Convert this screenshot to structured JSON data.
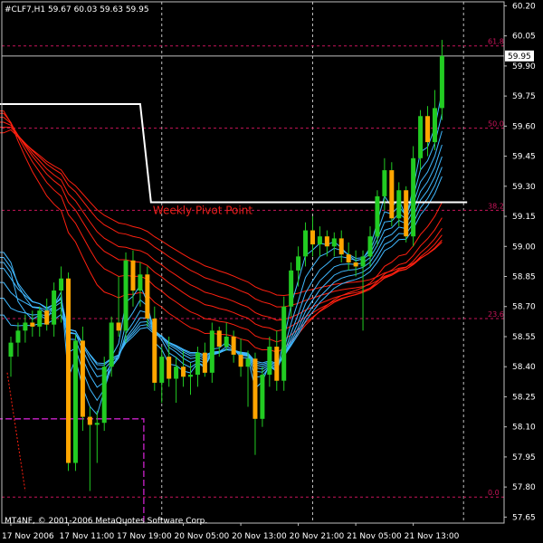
{
  "header": {
    "symbol_line": "#CLF7,H1  59.67 60.03 59.63 59.95"
  },
  "footer": {
    "copyright": "MT4NF, © 2001-2006 MetaQuotes Software Corp."
  },
  "colors": {
    "background": "#000000",
    "grid": "#c0c0c0",
    "bull": "#22cc22",
    "bear": "#ffa500",
    "wick": "#22cc22",
    "fib": "#c8145a",
    "pivot": "#ffffff",
    "pivot_label": "#e8201a",
    "red_ema": "#ff2010",
    "cyan_ema": "#40b8ff",
    "magenta": "#cc22cc",
    "current_price_bg": "#ffffff",
    "current_price_fg": "#000000"
  },
  "chart_data": {
    "type": "candlestick",
    "symbol": "#CLF7",
    "timeframe": "H1",
    "ohlc_last": {
      "open": 59.67,
      "high": 60.03,
      "low": 59.63,
      "close": 59.95
    },
    "current_price": "59.95",
    "y_axis": {
      "ylim": [
        57.62,
        60.22
      ],
      "ticks": [
        "60.20",
        "60.05",
        "59.90",
        "59.75",
        "59.60",
        "59.45",
        "59.30",
        "59.15",
        "59.00",
        "58.85",
        "58.70",
        "58.55",
        "58.40",
        "58.25",
        "58.10",
        "57.95",
        "57.80",
        "57.65"
      ]
    },
    "x_axis": {
      "labels": [
        "17 Nov 2006",
        "17 Nov 11:00",
        "17 Nov 19:00",
        "20 Nov 05:00",
        "20 Nov 13:00",
        "20 Nov 21:00",
        "21 Nov 05:00",
        "21 Nov 13:00"
      ],
      "label_bars": [
        0,
        8,
        16,
        24,
        32,
        40,
        48,
        56
      ],
      "gridline_bars": [
        21,
        42,
        63
      ]
    },
    "fib_levels": [
      {
        "label": "61.8",
        "price": 60.0
      },
      {
        "label": "50.0",
        "price": 59.59
      },
      {
        "label": "38.2",
        "price": 59.18
      },
      {
        "label": "23.6",
        "price": 58.64
      },
      {
        "label": "0.0",
        "price": 57.75
      }
    ],
    "weekly_pivot": {
      "label": "Weekly Pivot Point",
      "segments": [
        {
          "from_bar": -2,
          "to_bar": 18,
          "price": 59.71
        },
        {
          "from_bar": 19.5,
          "to_bar": 63.5,
          "price": 59.22
        }
      ]
    },
    "magenta_level": {
      "price": 58.14,
      "from_bar": -2,
      "to_bar": 18.5,
      "drop_to": 57.62
    },
    "candles": [
      {
        "o": 58.45,
        "h": 58.55,
        "l": 58.35,
        "c": 58.52
      },
      {
        "o": 58.52,
        "h": 58.62,
        "l": 58.45,
        "c": 58.58
      },
      {
        "o": 58.58,
        "h": 58.66,
        "l": 58.52,
        "c": 58.62
      },
      {
        "o": 58.62,
        "h": 58.68,
        "l": 58.55,
        "c": 58.6
      },
      {
        "o": 58.6,
        "h": 58.7,
        "l": 58.55,
        "c": 58.68
      },
      {
        "o": 58.68,
        "h": 58.74,
        "l": 58.58,
        "c": 58.61
      },
      {
        "o": 58.61,
        "h": 58.82,
        "l": 58.55,
        "c": 58.78
      },
      {
        "o": 58.78,
        "h": 58.9,
        "l": 58.62,
        "c": 58.84
      },
      {
        "o": 58.84,
        "h": 58.87,
        "l": 57.88,
        "c": 57.92
      },
      {
        "o": 57.92,
        "h": 58.56,
        "l": 57.88,
        "c": 58.53
      },
      {
        "o": 58.53,
        "h": 58.6,
        "l": 58.08,
        "c": 58.15
      },
      {
        "o": 58.15,
        "h": 58.2,
        "l": 57.78,
        "c": 58.11
      },
      {
        "o": 58.11,
        "h": 58.18,
        "l": 57.92,
        "c": 58.12
      },
      {
        "o": 58.12,
        "h": 58.45,
        "l": 58.08,
        "c": 58.4
      },
      {
        "o": 58.4,
        "h": 58.65,
        "l": 58.35,
        "c": 58.62
      },
      {
        "o": 58.62,
        "h": 58.85,
        "l": 58.55,
        "c": 58.58
      },
      {
        "o": 58.58,
        "h": 58.97,
        "l": 58.52,
        "c": 58.93
      },
      {
        "o": 58.93,
        "h": 58.98,
        "l": 58.7,
        "c": 58.78
      },
      {
        "o": 58.78,
        "h": 58.92,
        "l": 58.7,
        "c": 58.86
      },
      {
        "o": 58.86,
        "h": 58.9,
        "l": 58.6,
        "c": 58.64
      },
      {
        "o": 58.64,
        "h": 58.7,
        "l": 58.28,
        "c": 58.32
      },
      {
        "o": 58.32,
        "h": 58.5,
        "l": 58.22,
        "c": 58.45
      },
      {
        "o": 58.45,
        "h": 58.55,
        "l": 58.3,
        "c": 58.34
      },
      {
        "o": 58.34,
        "h": 58.45,
        "l": 58.22,
        "c": 58.4
      },
      {
        "o": 58.4,
        "h": 58.48,
        "l": 58.3,
        "c": 58.35
      },
      {
        "o": 58.35,
        "h": 58.42,
        "l": 58.26,
        "c": 58.36
      },
      {
        "o": 58.36,
        "h": 58.5,
        "l": 58.3,
        "c": 58.47
      },
      {
        "o": 58.47,
        "h": 58.52,
        "l": 58.35,
        "c": 58.37
      },
      {
        "o": 58.37,
        "h": 58.62,
        "l": 58.32,
        "c": 58.58
      },
      {
        "o": 58.58,
        "h": 58.6,
        "l": 58.45,
        "c": 58.5
      },
      {
        "o": 58.5,
        "h": 58.62,
        "l": 58.48,
        "c": 58.55
      },
      {
        "o": 58.55,
        "h": 58.58,
        "l": 58.42,
        "c": 58.46
      },
      {
        "o": 58.46,
        "h": 58.54,
        "l": 58.35,
        "c": 58.4
      },
      {
        "o": 58.4,
        "h": 58.48,
        "l": 58.2,
        "c": 58.44
      },
      {
        "o": 58.44,
        "h": 58.47,
        "l": 57.96,
        "c": 58.14
      },
      {
        "o": 58.14,
        "h": 58.4,
        "l": 58.1,
        "c": 58.36
      },
      {
        "o": 58.36,
        "h": 58.55,
        "l": 58.3,
        "c": 58.5
      },
      {
        "o": 58.5,
        "h": 58.58,
        "l": 58.28,
        "c": 58.33
      },
      {
        "o": 58.33,
        "h": 58.75,
        "l": 58.28,
        "c": 58.7
      },
      {
        "o": 58.7,
        "h": 58.92,
        "l": 58.65,
        "c": 58.88
      },
      {
        "o": 58.88,
        "h": 59.0,
        "l": 58.8,
        "c": 58.95
      },
      {
        "o": 58.95,
        "h": 59.12,
        "l": 58.9,
        "c": 59.08
      },
      {
        "o": 59.08,
        "h": 59.15,
        "l": 58.95,
        "c": 59.01
      },
      {
        "o": 59.01,
        "h": 59.1,
        "l": 58.95,
        "c": 59.05
      },
      {
        "o": 59.05,
        "h": 59.08,
        "l": 58.95,
        "c": 59.0
      },
      {
        "o": 59.0,
        "h": 59.07,
        "l": 58.95,
        "c": 59.04
      },
      {
        "o": 59.04,
        "h": 59.08,
        "l": 58.92,
        "c": 58.96
      },
      {
        "o": 58.96,
        "h": 59.02,
        "l": 58.88,
        "c": 58.92
      },
      {
        "o": 58.92,
        "h": 58.98,
        "l": 58.85,
        "c": 58.9
      },
      {
        "o": 58.9,
        "h": 58.98,
        "l": 58.58,
        "c": 58.95
      },
      {
        "o": 58.95,
        "h": 59.1,
        "l": 58.9,
        "c": 59.05
      },
      {
        "o": 59.05,
        "h": 59.28,
        "l": 59.0,
        "c": 59.25
      },
      {
        "o": 59.25,
        "h": 59.44,
        "l": 59.18,
        "c": 59.38
      },
      {
        "o": 59.38,
        "h": 59.42,
        "l": 59.1,
        "c": 59.14
      },
      {
        "o": 59.14,
        "h": 59.32,
        "l": 59.1,
        "c": 59.28
      },
      {
        "o": 59.28,
        "h": 59.3,
        "l": 59.02,
        "c": 59.05
      },
      {
        "o": 59.05,
        "h": 59.5,
        "l": 59.0,
        "c": 59.44
      },
      {
        "o": 59.44,
        "h": 59.68,
        "l": 59.38,
        "c": 59.65
      },
      {
        "o": 59.65,
        "h": 59.7,
        "l": 59.45,
        "c": 59.52
      },
      {
        "o": 59.52,
        "h": 59.78,
        "l": 59.48,
        "c": 59.69
      },
      {
        "o": 59.69,
        "h": 60.03,
        "l": 59.63,
        "c": 59.95
      }
    ]
  }
}
